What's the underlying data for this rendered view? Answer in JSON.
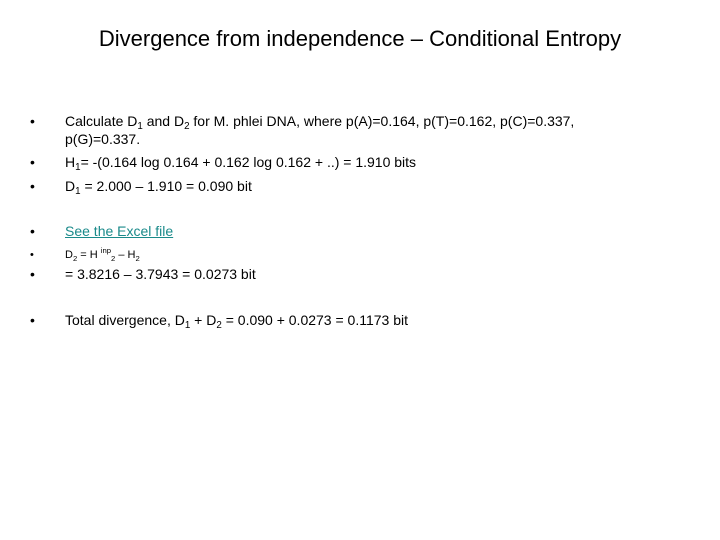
{
  "slide": {
    "title": "Divergence from independence – Conditional Entropy",
    "bullet_char": "•",
    "bullets": [
      {
        "parts": {
          "a": "Calculate D",
          "a_sub": "1",
          "b": " and D",
          "b_sub": "2",
          "c": " for M. phlei DNA, where p(A)=0.164, p(T)=0.162, p(C)=0.337,",
          "line2": "p(G)=0.337."
        }
      },
      {
        "parts": {
          "a": "H",
          "a_sub": "1",
          "b": "= -(0.164 log 0.164 + 0.162 log 0.162 + ..) = 1.910 bits"
        }
      },
      {
        "parts": {
          "a": "D",
          "a_sub": "1",
          "b": " = 2.000 – 1.910 = 0.090 bit"
        }
      },
      {
        "link_text": "See the Excel file",
        "link_color": "#1a8a8a"
      },
      {
        "parts": {
          "a": "D",
          "a_sub": "2",
          "b": " = H ",
          "b_sup": "inp",
          "b_sub": "2",
          "c": " – H",
          "c_sub": "2"
        }
      },
      {
        "parts": {
          "a": "= 3.8216 – 3.7943 = 0.0273 bit"
        }
      },
      {
        "parts": {
          "a": "Total divergence, D",
          "a_sub": "1",
          "b": " + D",
          "b_sub": "2",
          "c": " = 0.090 + 0.0273 = 0.1173 bit"
        }
      }
    ]
  }
}
